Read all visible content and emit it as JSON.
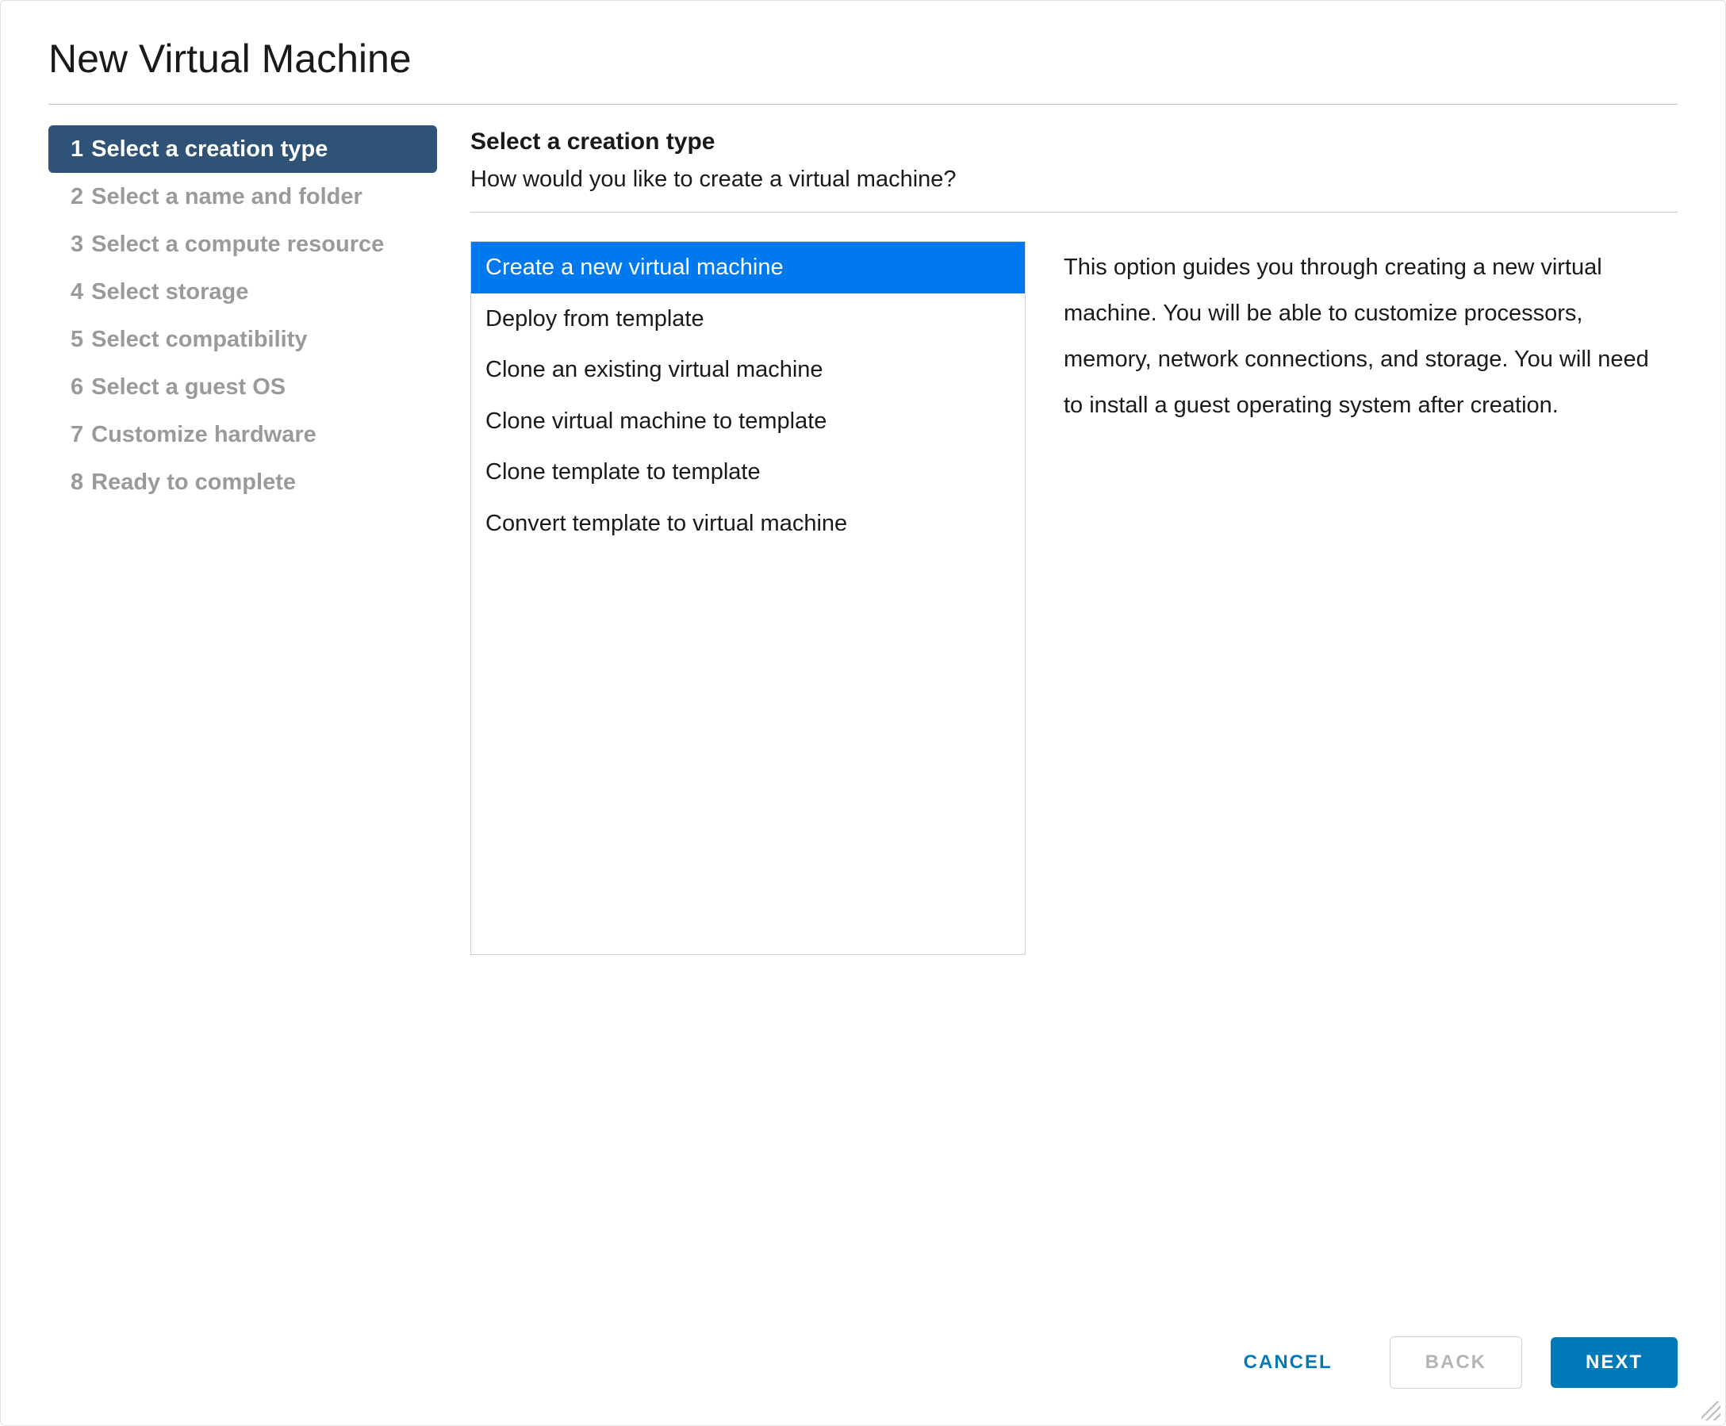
{
  "dialog": {
    "title": "New Virtual Machine"
  },
  "steps": [
    {
      "num": "1",
      "label": "Select a creation type",
      "active": true
    },
    {
      "num": "2",
      "label": "Select a name and folder",
      "active": false
    },
    {
      "num": "3",
      "label": "Select a compute resource",
      "active": false
    },
    {
      "num": "4",
      "label": "Select storage",
      "active": false
    },
    {
      "num": "5",
      "label": "Select compatibility",
      "active": false
    },
    {
      "num": "6",
      "label": "Select a guest OS",
      "active": false
    },
    {
      "num": "7",
      "label": "Customize hardware",
      "active": false
    },
    {
      "num": "8",
      "label": "Ready to complete",
      "active": false
    }
  ],
  "content": {
    "title": "Select a creation type",
    "subtitle": "How would you like to create a virtual machine?"
  },
  "options": [
    {
      "label": "Create a new virtual machine",
      "selected": true
    },
    {
      "label": "Deploy from template",
      "selected": false
    },
    {
      "label": "Clone an existing virtual machine",
      "selected": false
    },
    {
      "label": "Clone virtual machine to template",
      "selected": false
    },
    {
      "label": "Clone template to template",
      "selected": false
    },
    {
      "label": "Convert template to virtual machine",
      "selected": false
    }
  ],
  "description": "This option guides you through creating a new virtual machine. You will be able to customize processors, memory, network connections, and storage. You will need to install a guest operating system after creation.",
  "footer": {
    "cancel": "CANCEL",
    "back": "BACK",
    "next": "NEXT"
  }
}
